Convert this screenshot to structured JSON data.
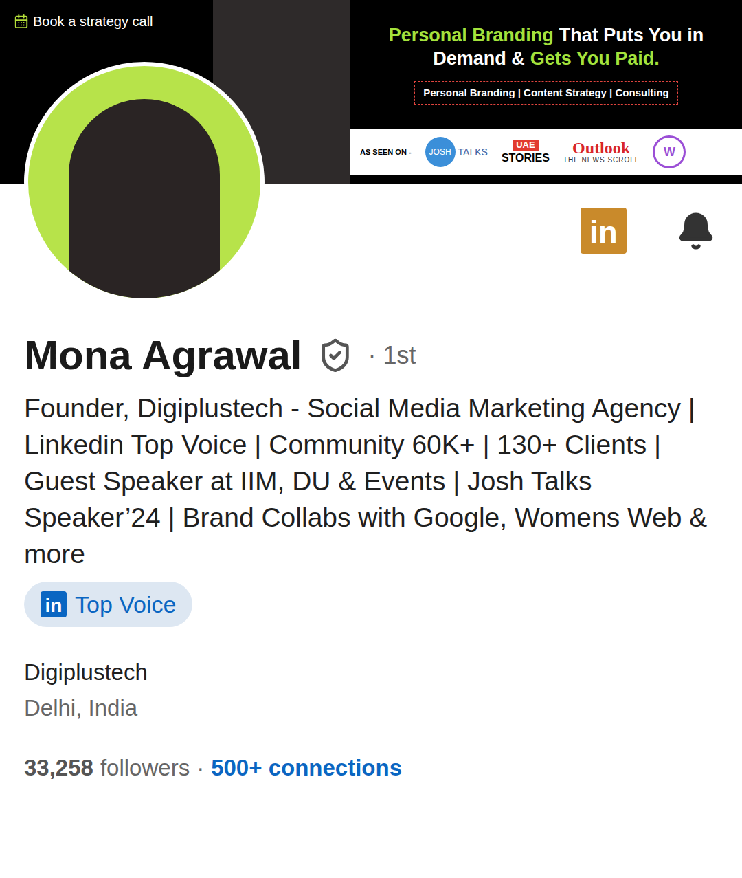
{
  "banner": {
    "cta": "Book a strategy call",
    "headline_lines": [
      [
        {
          "text": "Personal Branding",
          "color": "#a4e23c"
        },
        {
          "text": "That Puts You in",
          "color": "#ffffff"
        }
      ],
      [
        {
          "text": "Demand &",
          "color": "#ffffff"
        },
        {
          "text": "Gets You Paid.",
          "color": "#a4e23c"
        }
      ]
    ],
    "services": "Personal Branding | Content Strategy | Consulting",
    "as_seen_on": {
      "label": "AS SEEN ON -",
      "logos": [
        {
          "kind": "josh",
          "parts": [
            "JOSH",
            "TALKS"
          ]
        },
        {
          "kind": "uae",
          "parts": [
            "UAE",
            "STORIES"
          ]
        },
        {
          "kind": "outlook",
          "parts": [
            "Outlook",
            "THE NEWS SCROLL"
          ]
        },
        {
          "kind": "women",
          "parts": [
            "W"
          ]
        }
      ]
    }
  },
  "actions": {
    "linkedin_button": {
      "label": "in"
    },
    "notifications": {
      "on": true
    }
  },
  "profile": {
    "name": "Mona Agrawal",
    "verified": true,
    "degree": "· 1st",
    "headline": "Founder, Digiplustech - Social Media Marketing Agency | Linkedin Top Voice | Community 60K+ | 130+ Clients | Guest Speaker at IIM, DU & Events | Josh Talks Speaker’24 | Brand Collabs with Google, Womens Web & more",
    "badge": {
      "icon_label": "in",
      "label": "Top Voice"
    },
    "company": "Digiplustech",
    "location": "Delhi, India",
    "followers_count": "33,258",
    "followers_label": "followers",
    "separator": "·",
    "connections": "500+ connections"
  }
}
